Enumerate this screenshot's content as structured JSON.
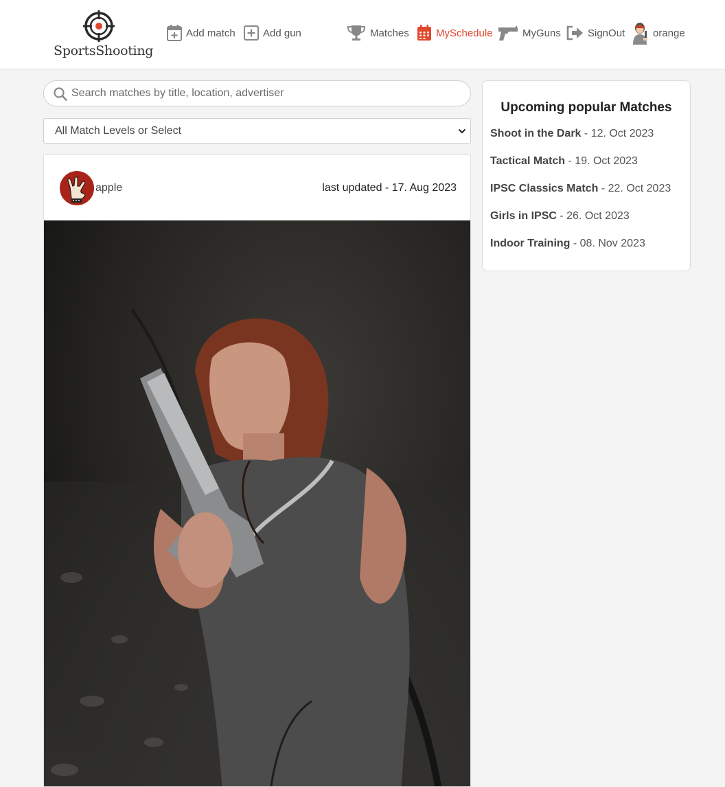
{
  "brand": {
    "name": "SportsShooting",
    "accent": "#e0472c"
  },
  "nav": {
    "add_match": {
      "label": "Add match",
      "icon": "calendar-plus-icon"
    },
    "add_gun": {
      "label": "Add gun",
      "icon": "square-plus-icon"
    },
    "matches": {
      "label": "Matches",
      "icon": "trophy-icon"
    },
    "my_schedule": {
      "label": "MySchedule",
      "icon": "calendar-icon",
      "active": true
    },
    "my_guns": {
      "label": "MyGuns",
      "icon": "pistol-icon"
    },
    "sign_out": {
      "label": "SignOut",
      "icon": "sign-out-icon"
    },
    "user": {
      "label": "orange",
      "icon": "user-avatar"
    }
  },
  "search": {
    "placeholder": "Search matches by title, location, advertiser",
    "value": ""
  },
  "level_filter": {
    "selected": "All Match Levels or Select"
  },
  "post": {
    "author": "apple",
    "updated": "last updated - 17. Aug 2023"
  },
  "sidebar": {
    "title": "Upcoming popular Matches",
    "items": [
      {
        "title": "Shoot in the Dark",
        "date": " - 12. Oct 2023"
      },
      {
        "title": "Tactical Match",
        "date": " - 19. Oct 2023"
      },
      {
        "title": "IPSC Classics Match",
        "date": " - 22. Oct 2023"
      },
      {
        "title": "Girls in IPSC",
        "date": " - 26. Oct 2023"
      },
      {
        "title": "Indoor Training",
        "date": " - 08. Nov 2023"
      }
    ]
  }
}
